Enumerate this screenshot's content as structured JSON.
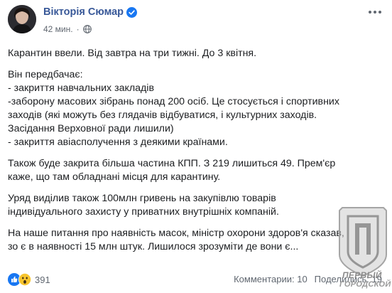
{
  "post": {
    "author_name": "Вікторія Сюмар",
    "time": "42 мин.",
    "meta_separator": "·",
    "paragraphs": [
      {
        "lines": [
          "Карантин ввели. Від завтра на три тижні. До 3 квітня."
        ]
      },
      {
        "lines": [
          "Він передбачає:",
          "- закриття навчальних закладів",
          "-заборону масових зібрань понад 200 осіб. Це стосується і спортивних",
          "заходів (які можуть без глядачів відбуватися, і культурних заходів.",
          "Засідання Верховної ради лишили)",
          "- закриття авіасполучення з деякими країнами."
        ]
      },
      {
        "lines": [
          "Також буде закрита більша частина КПП. З 219 лишиться 49. Прем'єр",
          "каже, що там обладнані місця для карантину."
        ]
      },
      {
        "lines": [
          "Уряд виділив також 100млн гривень на закупівлю товарів",
          "індивідуального захисту у приватних внутрішніх компаній."
        ]
      },
      {
        "lines": [
          "На наше питання про наявність масок, міністр охорони здоров'я сказав,",
          "зо є в наявності 15 млн штук. Лишилося зрозуміти де вони є..."
        ]
      }
    ]
  },
  "footer": {
    "reactions_count": "391",
    "reaction_icons": [
      "like-icon",
      "wow-icon"
    ],
    "comments_label": "Комментарии: 10",
    "shares_label": "Поделились: 19"
  },
  "watermark": {
    "line1": "ПЕРВЫЙ",
    "line2": "ГОРОДСКОЙ"
  },
  "colors": {
    "link_blue": "#385898",
    "verified_blue": "#1877f2",
    "meta_gray": "#606770",
    "text": "#1c1e21"
  }
}
